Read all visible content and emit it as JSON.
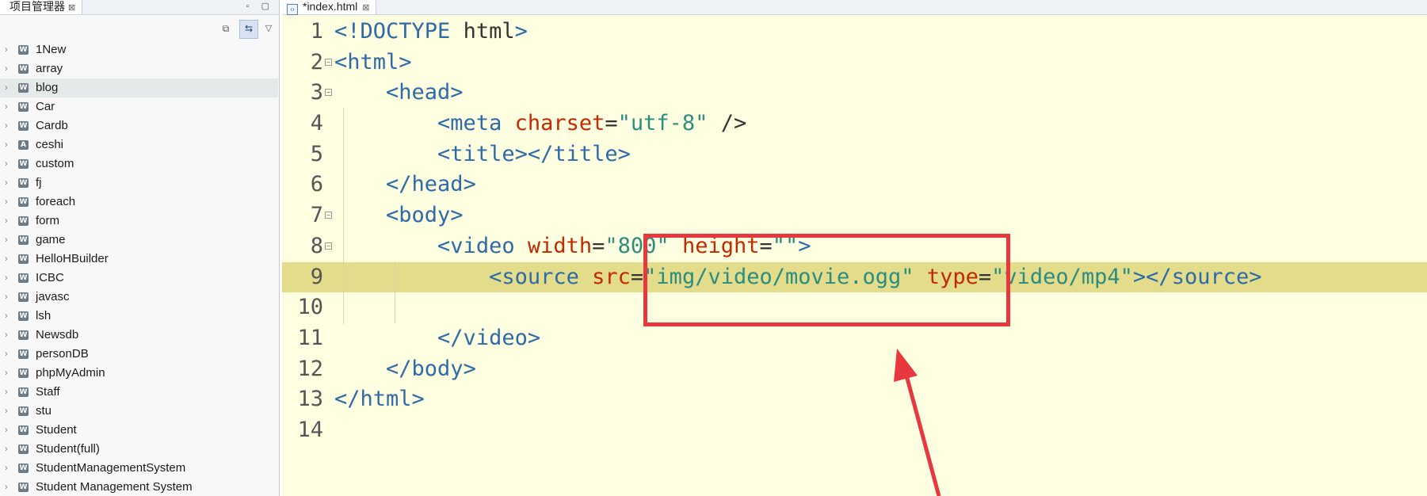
{
  "explorer": {
    "tab_label": "项目管理器",
    "tab_close": "⊠",
    "window_controls": "▫ ▢",
    "toolbar": {
      "collapse_icon": "⧉",
      "link_icon": "⇆",
      "menu_icon": "▽"
    },
    "chevron": "›",
    "selected_index": 2,
    "items": [
      {
        "label": "1New",
        "icon": "W"
      },
      {
        "label": "array",
        "icon": "W"
      },
      {
        "label": "blog",
        "icon": "W"
      },
      {
        "label": "Car",
        "icon": "W"
      },
      {
        "label": "Cardb",
        "icon": "W"
      },
      {
        "label": "ceshi",
        "icon": "A"
      },
      {
        "label": "custom",
        "icon": "W"
      },
      {
        "label": "fj",
        "icon": "W"
      },
      {
        "label": "foreach",
        "icon": "W"
      },
      {
        "label": "form",
        "icon": "W"
      },
      {
        "label": "game",
        "icon": "W"
      },
      {
        "label": "HelloHBuilder",
        "icon": "W"
      },
      {
        "label": "ICBC",
        "icon": "W"
      },
      {
        "label": "javasc",
        "icon": "W"
      },
      {
        "label": "lsh",
        "icon": "W"
      },
      {
        "label": "Newsdb",
        "icon": "W"
      },
      {
        "label": "personDB",
        "icon": "W"
      },
      {
        "label": "phpMyAdmin",
        "icon": "W"
      },
      {
        "label": "Staff",
        "icon": "W"
      },
      {
        "label": "stu",
        "icon": "W"
      },
      {
        "label": "Student",
        "icon": "W"
      },
      {
        "label": "Student(full)",
        "icon": "W"
      },
      {
        "label": "StudentManagementSystem",
        "icon": "W"
      },
      {
        "label": "Student Management System",
        "icon": "W"
      }
    ]
  },
  "editor": {
    "tab_label": "*index.html",
    "tab_icon": "‹›",
    "tab_close": "⊠",
    "current_line": 9,
    "fold_marker": "−",
    "lines": [
      {
        "num": "1",
        "fold": false,
        "tokens": [
          {
            "t": "<!",
            "c": "tg"
          },
          {
            "t": "DOCTYPE",
            "c": "tg"
          },
          {
            "t": " html",
            "c": "pu"
          },
          {
            "t": ">",
            "c": "tg"
          }
        ]
      },
      {
        "num": "2",
        "fold": true,
        "tokens": [
          {
            "t": "<html>",
            "c": "tg"
          }
        ]
      },
      {
        "num": "3",
        "fold": true,
        "tokens": [
          {
            "t": "    ",
            "c": "pu"
          },
          {
            "t": "<head>",
            "c": "tg"
          }
        ]
      },
      {
        "num": "4",
        "fold": false,
        "tokens": [
          {
            "t": "        ",
            "c": "pu"
          },
          {
            "t": "<meta ",
            "c": "tg"
          },
          {
            "t": "charset",
            "c": "at"
          },
          {
            "t": "=",
            "c": "pu"
          },
          {
            "t": "\"utf-8\"",
            "c": "st"
          },
          {
            "t": " />",
            "c": "pu"
          }
        ]
      },
      {
        "num": "5",
        "fold": false,
        "tokens": [
          {
            "t": "        ",
            "c": "pu"
          },
          {
            "t": "<title></title>",
            "c": "tg"
          }
        ]
      },
      {
        "num": "6",
        "fold": false,
        "tokens": [
          {
            "t": "    ",
            "c": "pu"
          },
          {
            "t": "</head>",
            "c": "tg"
          }
        ]
      },
      {
        "num": "7",
        "fold": true,
        "tokens": [
          {
            "t": "    ",
            "c": "pu"
          },
          {
            "t": "<body>",
            "c": "tg"
          }
        ]
      },
      {
        "num": "8",
        "fold": true,
        "tokens": [
          {
            "t": "        ",
            "c": "pu"
          },
          {
            "t": "<video ",
            "c": "tg"
          },
          {
            "t": "width",
            "c": "at"
          },
          {
            "t": "=",
            "c": "pu"
          },
          {
            "t": "\"800\"",
            "c": "st"
          },
          {
            "t": " ",
            "c": "pu"
          },
          {
            "t": "height",
            "c": "at"
          },
          {
            "t": "=",
            "c": "pu"
          },
          {
            "t": "\"\"",
            "c": "st"
          },
          {
            "t": ">",
            "c": "tg"
          }
        ]
      },
      {
        "num": "9",
        "fold": false,
        "tokens": [
          {
            "t": "            ",
            "c": "pu"
          },
          {
            "t": "<source ",
            "c": "tg"
          },
          {
            "t": "src",
            "c": "at"
          },
          {
            "t": "=",
            "c": "pu"
          },
          {
            "t": "\"img/video/movie.ogg\"",
            "c": "st"
          },
          {
            "t": " ",
            "c": "pu"
          },
          {
            "t": "type",
            "c": "at"
          },
          {
            "t": "=",
            "c": "pu"
          },
          {
            "t": "\"video/mp4\"",
            "c": "st"
          },
          {
            "t": "></source>",
            "c": "tg"
          }
        ]
      },
      {
        "num": "10",
        "fold": false,
        "tokens": []
      },
      {
        "num": "11",
        "fold": false,
        "tokens": [
          {
            "t": "        ",
            "c": "pu"
          },
          {
            "t": "</video>",
            "c": "tg"
          }
        ]
      },
      {
        "num": "12",
        "fold": false,
        "tokens": [
          {
            "t": "    ",
            "c": "pu"
          },
          {
            "t": "</body>",
            "c": "tg"
          }
        ]
      },
      {
        "num": "13",
        "fold": false,
        "tokens": [
          {
            "t": "</html>",
            "c": "tg"
          }
        ]
      },
      {
        "num": "14",
        "fold": false,
        "tokens": []
      }
    ]
  },
  "annotation": {
    "color": "#e8383d"
  }
}
